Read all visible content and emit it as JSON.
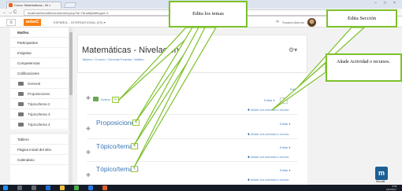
{
  "browser": {
    "tab_title": "Curso: Matemáticas - Ni ×",
    "url": "localhost/moodle/course/view.php?id=7&notifyeditingon=1",
    "nav_icons": [
      "←",
      "→",
      "C",
      "⌂"
    ]
  },
  "navbar": {
    "brand": "aulasC",
    "menu_text": "ESPAÑOL - INTERNATIONAL (ES) ▾",
    "user_name": "Susana Alarcón"
  },
  "drawer": {
    "items": [
      {
        "label": "Matfeu",
        "style": "bold"
      },
      {
        "label": "Participantes",
        "style": "normal"
      },
      {
        "label": "Insignias",
        "style": "normal"
      },
      {
        "label": "Competencias",
        "style": "normal"
      },
      {
        "label": "Calificaciones",
        "style": "normal"
      },
      {
        "label": "General",
        "style": "folder"
      },
      {
        "label": "Proposiciones",
        "style": "folder"
      },
      {
        "label": "Tópico/tema 2",
        "style": "folder"
      },
      {
        "label": "Tópico/tema 3",
        "style": "folder"
      },
      {
        "label": "Tópico/tema 4",
        "style": "folder"
      },
      {
        "label": "Tablero",
        "style": "normal"
      },
      {
        "label": "Página inicial del sitio",
        "style": "normal"
      },
      {
        "label": "Calendario",
        "style": "normal"
      }
    ]
  },
  "page": {
    "title": "Matemáticas - Nivelación",
    "breadcrumb": "Tablero / Cursos / Ciencias Exactas / Matfeu",
    "sections": [
      {
        "name": "Avisos",
        "edit": "Editar ▾",
        "add": "Añadir una actividad o recurso"
      },
      {
        "name": "Proposiciones",
        "edit": "Editar ▾",
        "add": "Añadir una actividad o recurso"
      },
      {
        "name": "Tópico/tema 2",
        "edit": "Editar ▾",
        "add": "Añadir una actividad o recurso"
      },
      {
        "name": "Tópico/tema 3",
        "edit": "Editar ▾",
        "add": "Añadir una actividad o recurso"
      }
    ],
    "top_edit": "Editar ▾",
    "pencil": "✎"
  },
  "callouts": {
    "edit_topics": "Edita los temas",
    "edit_section": "Edita Sección",
    "add_activity": "Añade Actividad o recursos."
  },
  "logo": {
    "letter": "m",
    "caption": "Moodle"
  },
  "taskbar": {
    "time": "8:58",
    "date": "18/3/2017"
  },
  "colors": {
    "accent": "#f98012",
    "link": "#4a86c5",
    "callout_border": "#7dc12b"
  }
}
